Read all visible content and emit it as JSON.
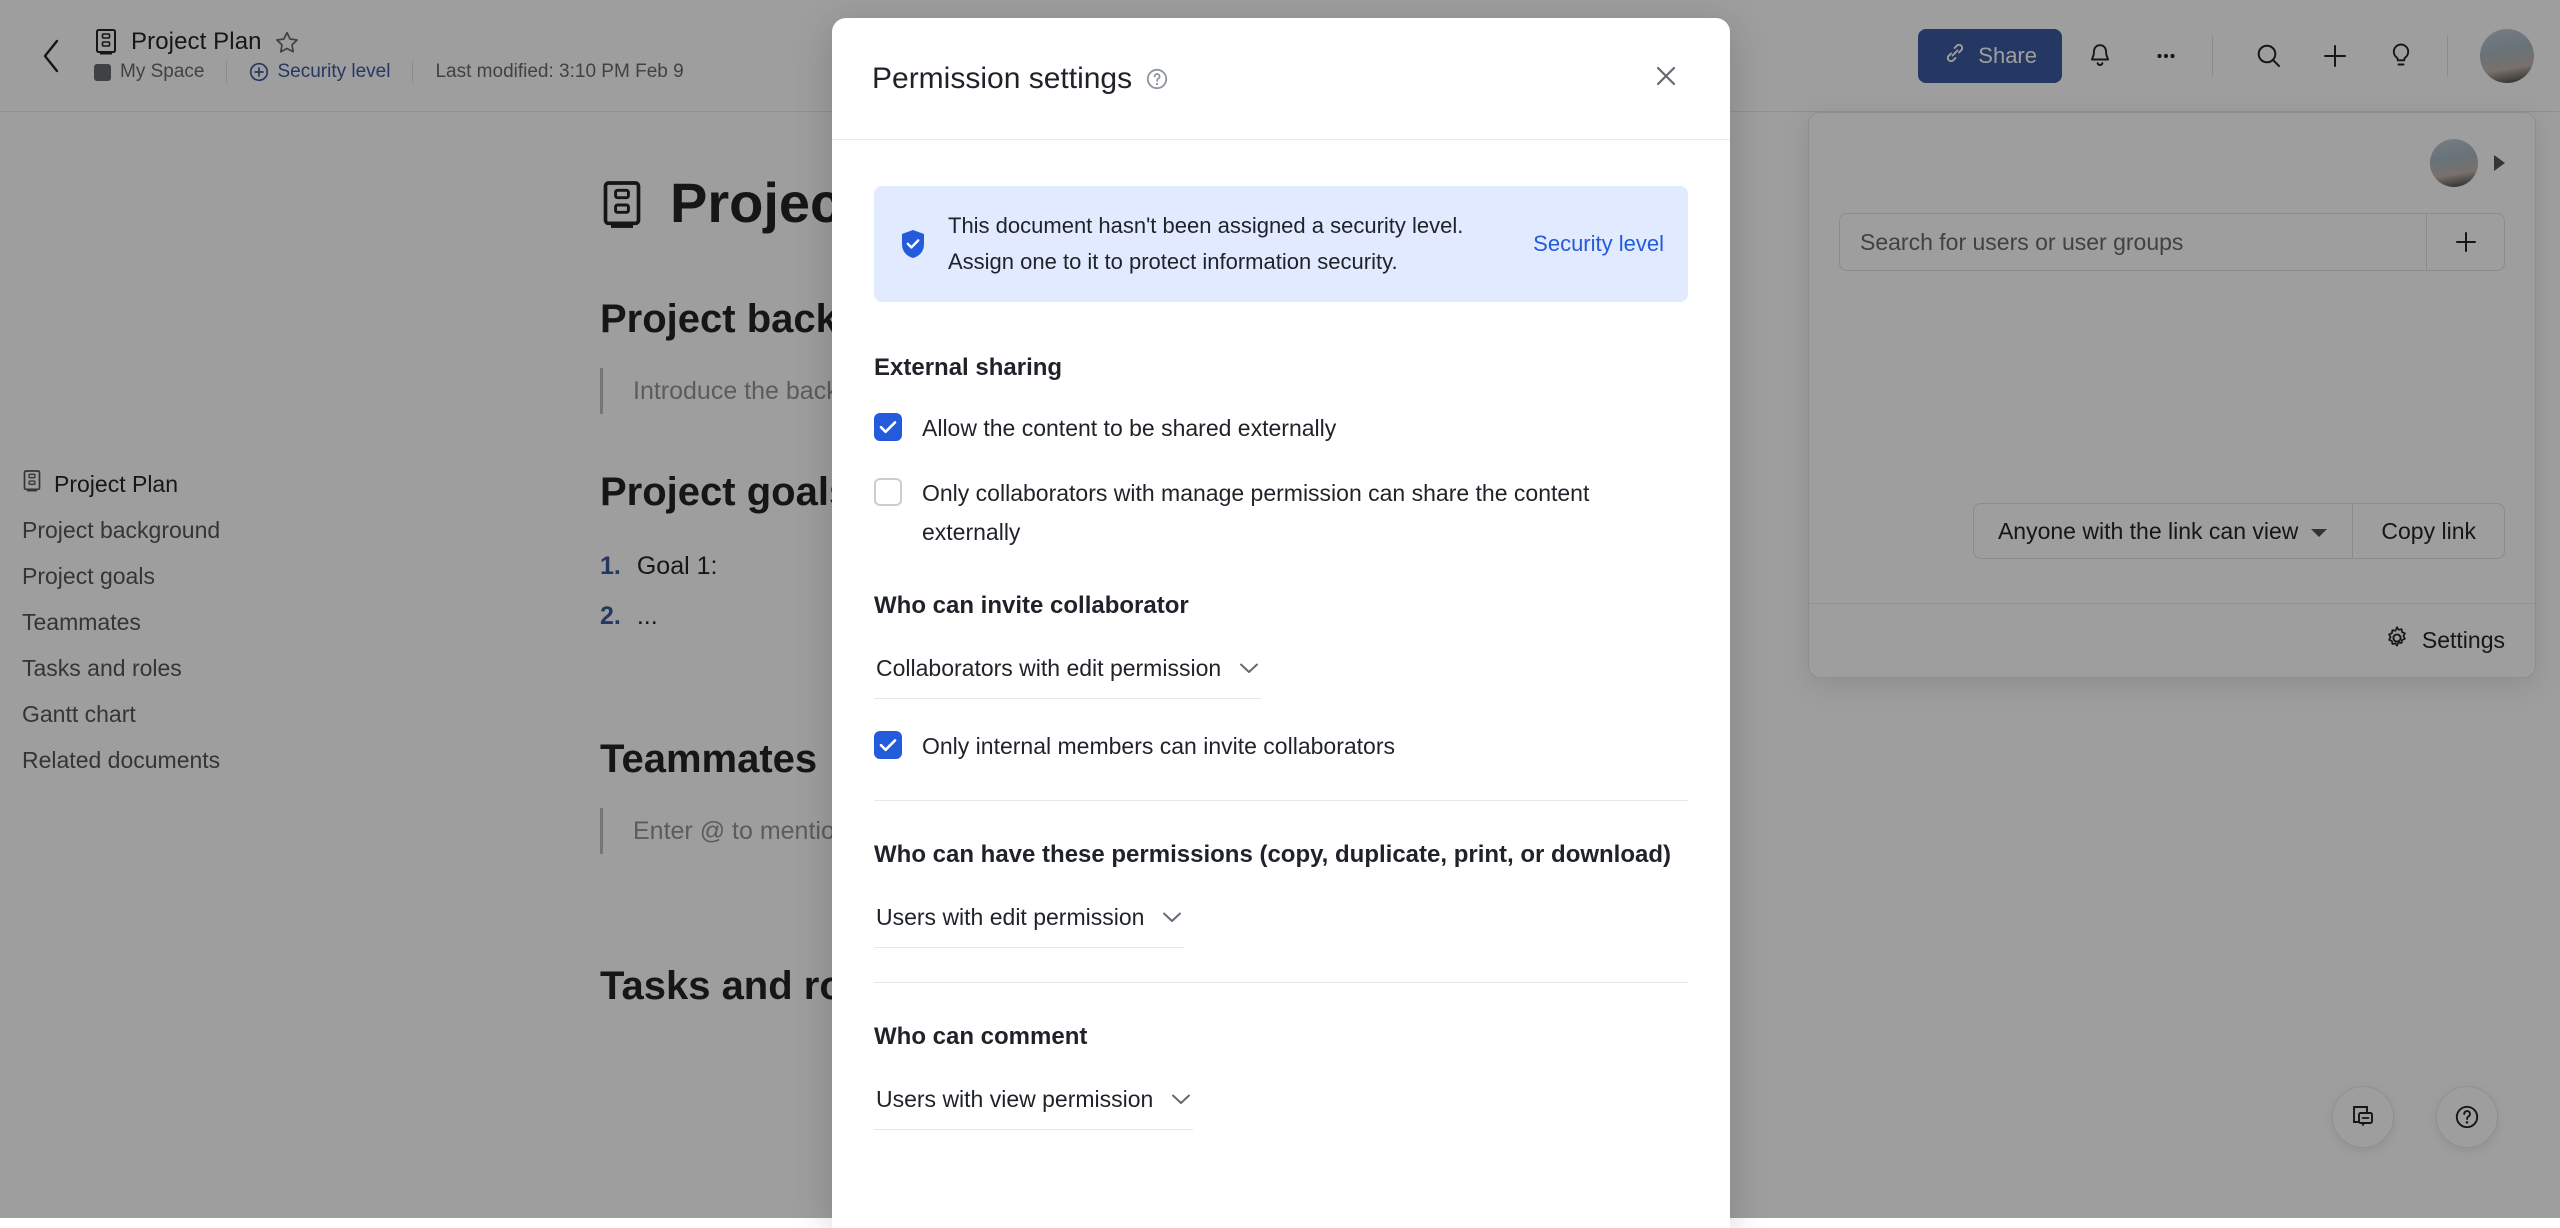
{
  "topbar": {
    "back_icon": "chevron-left-icon",
    "doc_icon": "file-cabinet-icon",
    "doc_title": "Project Plan",
    "star_icon": "star-outline-icon",
    "space_name": "My Space",
    "security_level": "Security level",
    "last_modified": "Last modified: 3:10 PM Feb 9",
    "share_label": "Share",
    "icons": {
      "bell": "bell-icon",
      "more": "more-horizontal-icon",
      "search": "search-icon",
      "plus": "plus-icon",
      "idea": "lightbulb-icon"
    }
  },
  "outline": {
    "items": [
      {
        "label": "Project Plan"
      },
      {
        "label": "Project background"
      },
      {
        "label": "Project goals"
      },
      {
        "label": "Teammates"
      },
      {
        "label": "Tasks and roles"
      },
      {
        "label": "Gantt chart"
      },
      {
        "label": "Related documents"
      }
    ]
  },
  "document": {
    "title": "Project Plan",
    "h_background": "Project background",
    "background_placeholder": "Introduce the background of the project",
    "h_goals": "Project goals",
    "goals": [
      {
        "num": "1.",
        "text": "Goal 1:"
      },
      {
        "num": "2.",
        "text": "..."
      }
    ],
    "h_teammates": "Teammates",
    "teammates_placeholder": "Enter @ to mention teammates",
    "h_tasks": "Tasks and roles"
  },
  "share_popover": {
    "search_placeholder": "Search for users or user groups",
    "add_icon": "plus-icon",
    "link_permission": "Anyone with the link can view",
    "link_permission_short": "view",
    "copy_link": "Copy link",
    "settings": "Settings",
    "settings_icon": "gear-icon"
  },
  "fabs": {
    "comments_icon": "comment-doc-icon",
    "help_icon": "question-circle-icon"
  },
  "modal": {
    "title": "Permission settings",
    "help_icon": "question-circle-icon",
    "close_icon": "close-icon",
    "banner": {
      "icon": "shield-check-icon",
      "text": "This document hasn't been assigned a security level. Assign one to it to protect information security.",
      "link": "Security level"
    },
    "external_sharing": {
      "title": "External sharing",
      "options": [
        {
          "label": "Allow the content to be shared externally",
          "checked": true
        },
        {
          "label": "Only collaborators with manage permission can share the content externally",
          "checked": false
        }
      ]
    },
    "invite": {
      "title": "Who can invite collaborator",
      "select_value": "Collaborators with edit permission",
      "checkbox": {
        "label": "Only internal members can invite collaborators",
        "checked": true
      }
    },
    "copy_perms": {
      "title": "Who can have these permissions (copy, duplicate, print, or download)",
      "select_value": "Users with edit permission"
    },
    "comment": {
      "title": "Who can comment",
      "select_value": "Users with view permission"
    }
  },
  "colors": {
    "accent": "#245bdb",
    "banner_bg": "#e1eaff",
    "text": "#1f2329",
    "muted": "#646a73"
  }
}
